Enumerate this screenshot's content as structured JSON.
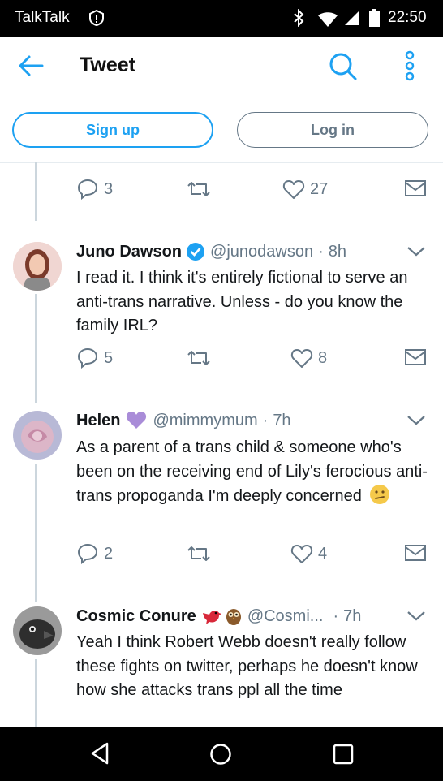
{
  "status_bar": {
    "carrier": "TalkTalk",
    "time": "22:50",
    "icons": [
      "alert-icon",
      "bluetooth-icon",
      "wifi-icon",
      "signal-icon",
      "battery-icon"
    ]
  },
  "header": {
    "title": "Tweet",
    "icons": [
      "back-arrow-icon",
      "search-icon",
      "more-vertical-icon"
    ]
  },
  "auth": {
    "signup_label": "Sign up",
    "login_label": "Log in"
  },
  "colors": {
    "accent": "#1da1f2",
    "muted": "#657786",
    "verified": "#1da1f2"
  },
  "top_actions": {
    "replies": "3",
    "retweets": "",
    "likes": "27"
  },
  "tweets": [
    {
      "name": "Juno Dawson",
      "verified": true,
      "handle": "@junodawson",
      "sep": "·",
      "time": "8h",
      "text": "I read it. I think it's entirely fictional to serve an anti-trans narrative. Unless - do you know the family IRL?",
      "replies": "5",
      "likes": "8"
    },
    {
      "name": "Helen",
      "emoji": "purple-heart-icon",
      "handle": "@mimmymum",
      "sep": "·",
      "time": "7h",
      "text": "As a parent of a trans child & someone who's been on the receiving end of Lily's ferocious anti-trans propoganda I'm deeply concerned",
      "emoji_after": "confused-face-icon",
      "replies": "2",
      "likes": "4"
    },
    {
      "name": "Cosmic Conure",
      "emoji": "bird-and-owl-icons",
      "handle": "@Cosmi...",
      "sep": "·",
      "time": "7h",
      "text": "Yeah I think Robert Webb doesn't really follow these fights on twitter, perhaps he doesn't know how she attacks trans ppl all the time"
    }
  ],
  "navigation": {
    "icons": [
      "nav-back-icon",
      "nav-home-icon",
      "nav-recents-icon"
    ]
  }
}
